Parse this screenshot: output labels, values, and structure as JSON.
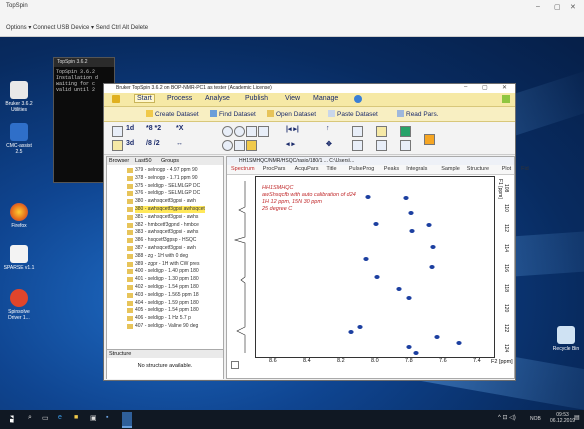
{
  "remote": {
    "title": "TopSpin",
    "menu_text": "Options ▾  Connect USB Device ▾  Send Ctrl Alt Delete",
    "controls": [
      "–",
      "▢",
      "✕"
    ]
  },
  "desktop_icons": [
    {
      "label": "Bruker 3.6.2 Utilities",
      "icon": "utilities-icon",
      "color": "#e8e8e8"
    },
    {
      "label": "CMC-assist 2.5",
      "icon": "cmc-icon",
      "color": "#2f6fc9"
    },
    {
      "label": "Firefox",
      "icon": "firefox-icon",
      "color": "#e56a1a"
    },
    {
      "label": "SPARSE v1.1",
      "icon": "file-icon",
      "color": "#f3f3f3"
    },
    {
      "label": "Spinsolve Driver 1...",
      "icon": "spinsolve-icon",
      "color": "#e0452b"
    },
    {
      "label": "Recycle Bin",
      "icon": "recycle-bin-icon",
      "color": "#cfe2f3"
    }
  ],
  "console": {
    "title": "TopSpin 3.6.2",
    "lines": [
      "TopSpin 3.6.2",
      "Installation d",
      "waiting for c",
      "valid until 2"
    ]
  },
  "topspin": {
    "title": "Bruker TopSpin 3.6.2 on BOP-NMR-PC1 as tester (Academic License)",
    "controls": [
      "–",
      "▢",
      "✕"
    ],
    "menus": [
      "Start",
      "Process",
      "Analyse",
      "Publish",
      "View",
      "Manage"
    ],
    "commands": [
      "Create Dataset",
      "Find Dataset",
      "Open Dataset",
      "Paste Dataset",
      "Read Pars."
    ],
    "toolbar_text": [
      "1d",
      "3d",
      "*8 *2",
      "/8 /2",
      "*X",
      "↔"
    ],
    "browser_tabs": [
      "Browser",
      "Last50",
      "Groups"
    ],
    "browser_rows": [
      "379 - selnogp - 4.97 ppm 90",
      "378 - selnogp - 1.71 ppm 90",
      "375 - seldigp - SELMLGP DC",
      "376 - seldigp - SELMLGP DC",
      "380 - awhsqcetf3gpsi - awh",
      "380 - awhsqcetf3gpsi awhsqcet",
      "381 - awhsqcetf3gpsi - awhs",
      "382 - hmbcetf3gpnd - hmbce",
      "383 - awhsqcetf3gpsi - awhs",
      "386 - hsqcetf3gpsp - HSQC",
      "387 - awhsqcetf3gpsi - awh",
      "388 - zg - 1H with 0 deg",
      "389 - zgpr - 1H with CW pres",
      "400 - seldigp - 1.40 ppm 180",
      "401 - seldigp - 1.30 ppm 180",
      "402 - seldigp - 1.54 ppm 180",
      "403 - seldigp - 1.565 ppm 18",
      "404 - seldigp - 1.59 ppm 180",
      "405 - seldigp - 1.54 ppm 180",
      "406 - seldigp - 1 Hz 5.7 p",
      "407 - seldigp - Valine 90 deg"
    ],
    "selected_row": 5,
    "structure_label": "Structure",
    "structure_empty": "No structure available.",
    "spectrum_path": "HH1SMHQC/NMR/HSQC/rasio/180/1 ... C:\\Users\\...",
    "spectrum_tabs": [
      "Spectrum",
      "ProcPars",
      "AcquPars",
      "Title",
      "PulseProg",
      "Peaks",
      "Integrals",
      "Sample",
      "Structure",
      "Plot",
      "Fid"
    ],
    "annotation": [
      "HH1SMHQC",
      "awShsqcfb with auto calibration of d24",
      "1H 12 ppm, 15N 30 ppm",
      "25 degree C"
    ],
    "y_axis_label": "F1 [ppm]",
    "y_ticks": [
      "108",
      "110",
      "112",
      "114",
      "116",
      "118",
      "120",
      "122",
      "124"
    ],
    "x_axis_label": "F2 [ppm]",
    "x_ticks": [
      "8.6",
      "8.4",
      "8.2",
      "8.0",
      "7.8",
      "7.6",
      "7.4"
    ]
  },
  "taskbar": {
    "time": "09:53",
    "date": "06.12.2019",
    "lang": "NOB"
  }
}
